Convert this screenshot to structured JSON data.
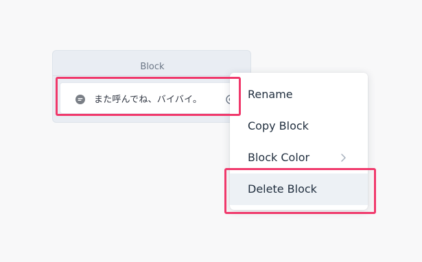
{
  "block": {
    "title": "Block",
    "item": {
      "text": "また呼んでね、バイバイ。",
      "icon": "chat-bubble-icon",
      "trailing_icon": "target-circle-icon"
    }
  },
  "context_menu": {
    "items": [
      {
        "label": "Rename"
      },
      {
        "label": "Copy Block"
      },
      {
        "label": "Block Color",
        "submenu_icon": "chevron-right-icon"
      },
      {
        "label": "Delete Block",
        "hovered": true
      }
    ]
  },
  "colors": {
    "highlight": "#f0386b",
    "menu_hover": "#edf1f5",
    "card_background": "#e9edf3"
  }
}
